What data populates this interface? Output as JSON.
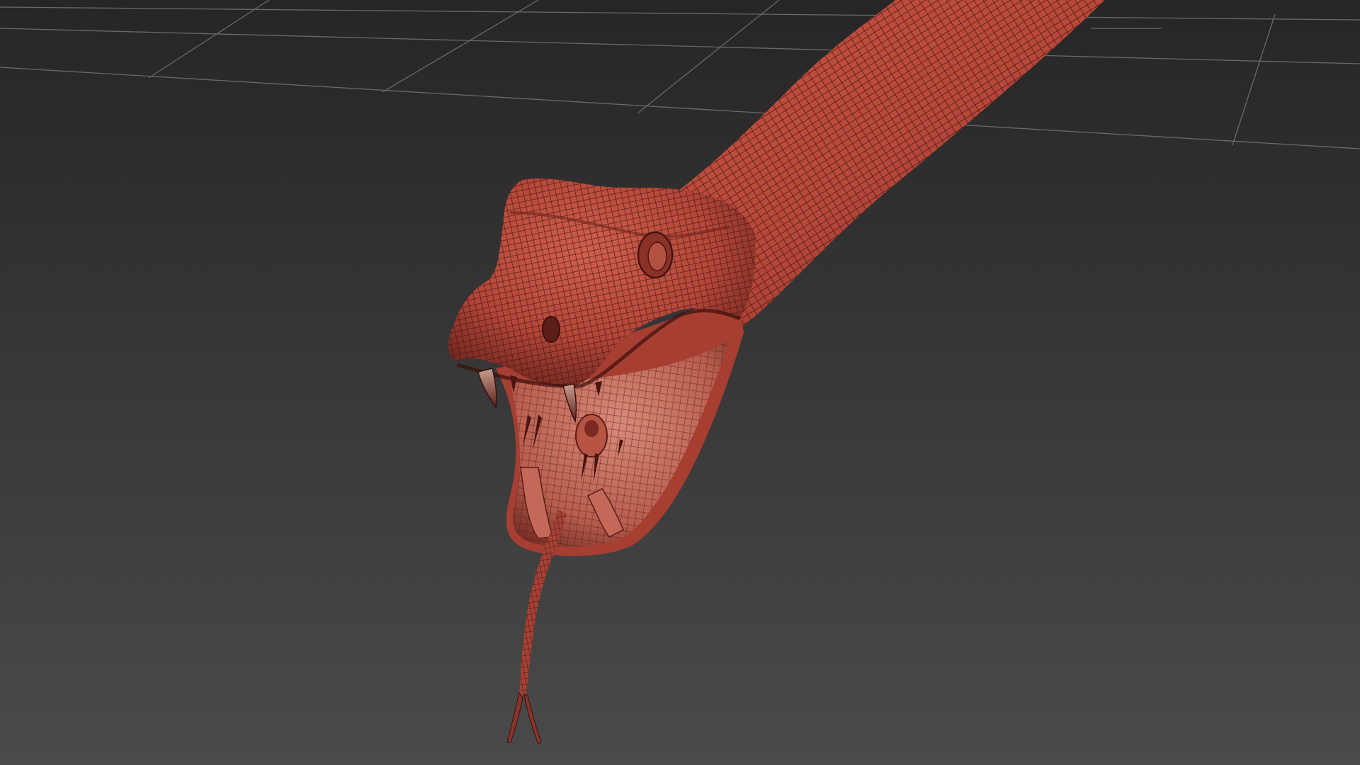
{
  "viewport": {
    "background_top": "#262626",
    "background_bottom": "#4a4a4a",
    "grid_color": "#7a7a7a"
  },
  "model": {
    "surface_color": "#b8483a",
    "surface_highlight": "#d0604e",
    "surface_shadow": "#6e2620",
    "wire_color": "#3a120e",
    "mouth_interior": "#c26a5a",
    "fang_color": "#d8b8a8"
  }
}
